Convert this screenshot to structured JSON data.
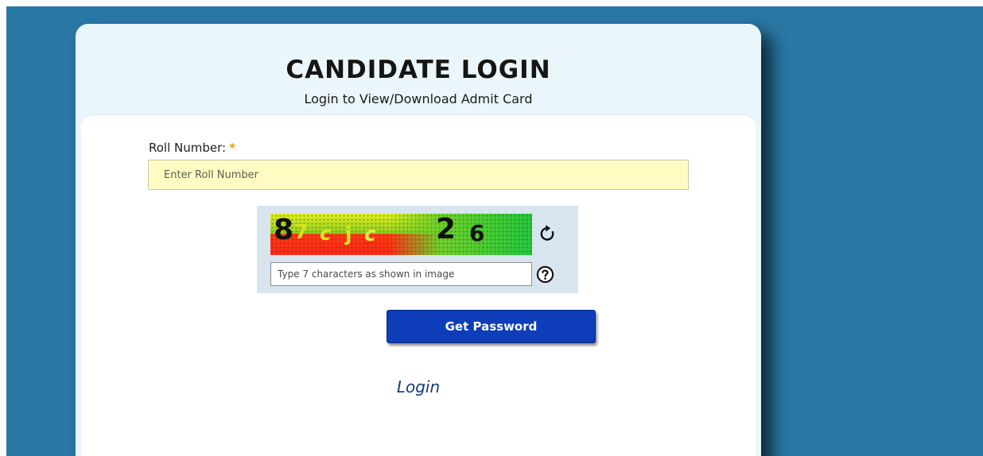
{
  "header": {
    "title": "CANDIDATE LOGIN",
    "subtitle": "Login to View/Download Admit Card"
  },
  "form": {
    "roll_label": "Roll Number:",
    "required_mark": "*",
    "roll_placeholder": "Enter Roll Number",
    "captcha_chars": [
      "8",
      "7",
      "c",
      "j",
      "c",
      "2",
      "6"
    ],
    "captcha_placeholder": "Type 7 characters as shown in image",
    "refresh_icon": "refresh-icon",
    "help_icon": "question-circle-icon",
    "submit_label": "Get Password",
    "login_link": "Login"
  },
  "colors": {
    "background": "#2a78a6",
    "card": "#ebf6fc",
    "input_highlight": "#fefcc3",
    "button": "#0d3db8",
    "required": "#e39b15",
    "link": "#133a7e"
  }
}
